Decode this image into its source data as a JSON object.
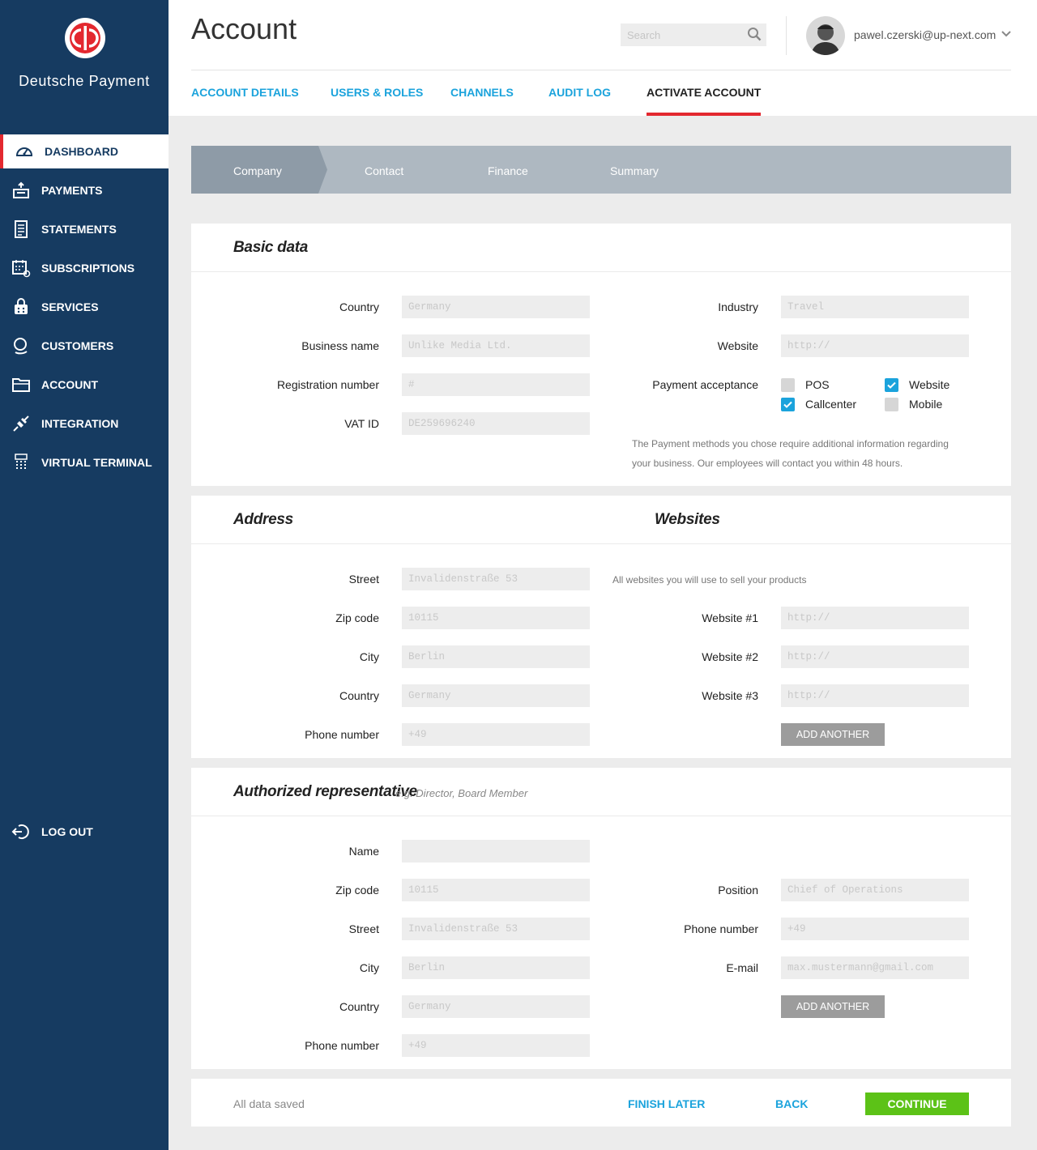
{
  "brand": {
    "name": "Deutsche Payment"
  },
  "sidebar": {
    "items": [
      {
        "label": "DASHBOARD",
        "icon": "dashboard-icon"
      },
      {
        "label": "PAYMENTS",
        "icon": "payments-icon"
      },
      {
        "label": "STATEMENTS",
        "icon": "statements-icon"
      },
      {
        "label": "SUBSCRIPTIONS",
        "icon": "subscriptions-icon"
      },
      {
        "label": "SERVICES",
        "icon": "services-icon"
      },
      {
        "label": "CUSTOMERS",
        "icon": "customers-icon"
      },
      {
        "label": "ACCOUNT",
        "icon": "account-icon"
      },
      {
        "label": "INTEGRATION",
        "icon": "integration-icon"
      },
      {
        "label": "VIRTUAL TERMINAL",
        "icon": "virtual-terminal-icon"
      }
    ],
    "logout": "LOG OUT"
  },
  "header": {
    "title": "Account",
    "search_placeholder": "Search",
    "user_email": "pawel.czerski@up-next.com"
  },
  "tabs": [
    "ACCOUNT DETAILS",
    "USERS & ROLES",
    "CHANNELS",
    "AUDIT LOG",
    "ACTIVATE ACCOUNT"
  ],
  "steps": [
    "Company",
    "Contact",
    "Finance",
    "Summary"
  ],
  "basic": {
    "title": "Basic data",
    "country_label": "Country",
    "country_ph": "Germany",
    "business_label": "Business name",
    "business_ph": "Unlike Media Ltd.",
    "reg_label": "Registration number",
    "reg_ph": "#",
    "vat_label": "VAT ID",
    "vat_ph": "DE259696240",
    "industry_label": "Industry",
    "industry_ph": "Travel",
    "website_label": "Website",
    "website_ph": "http://",
    "payment_label": "Payment acceptance",
    "options": [
      {
        "label": "POS",
        "checked": false
      },
      {
        "label": "Website",
        "checked": true
      },
      {
        "label": "Callcenter",
        "checked": true
      },
      {
        "label": "Mobile",
        "checked": false
      }
    ],
    "note_line1": "The Payment methods you chose require additional information regarding",
    "note_line2": "your business. Our employees will contact you within 48 hours."
  },
  "address": {
    "title": "Address",
    "street_label": "Street",
    "street_ph": "Invalidenstraße 53",
    "zip_label": "Zip code",
    "zip_ph": "10115",
    "city_label": "City",
    "city_ph": "Berlin",
    "country_label": "Country",
    "country_ph": "Germany",
    "phone_label": "Phone number",
    "phone_ph": "+49"
  },
  "websites": {
    "title": "Websites",
    "hint": "All websites you will use to sell your products",
    "w1_label": "Website #1",
    "w1_ph": "http://",
    "w2_label": "Website #2",
    "w2_ph": "http://",
    "w3_label": "Website #3",
    "w3_ph": "http://",
    "add_label": "ADD ANOTHER"
  },
  "rep": {
    "title": "Authorized representative",
    "hint": "e.g. Director, Board Member",
    "name_label": "Name",
    "name_ph": "",
    "zip_label": "Zip code",
    "zip_ph": "10115",
    "street_label": "Street",
    "street_ph": "Invalidenstraße 53",
    "city_label": "City",
    "city_ph": "Berlin",
    "country_label": "Country",
    "country_ph": "Germany",
    "phone_label": "Phone number",
    "phone_ph": "+49",
    "position_label": "Position",
    "position_ph": "Chief of Operations",
    "rphone_label": "Phone number",
    "rphone_ph": "+49",
    "email_label": "E-mail",
    "email_ph": "max.mustermann@gmail.com",
    "add_label": "ADD ANOTHER"
  },
  "footer": {
    "saved": "All data saved",
    "finish_later": "FINISH LATER",
    "back": "BACK",
    "continue": "CONTINUE"
  },
  "colors": {
    "sidebar": "#163b61",
    "accent_blue": "#1ba3dc",
    "accent_red": "#e3282f",
    "continue_green": "#5cc217"
  }
}
